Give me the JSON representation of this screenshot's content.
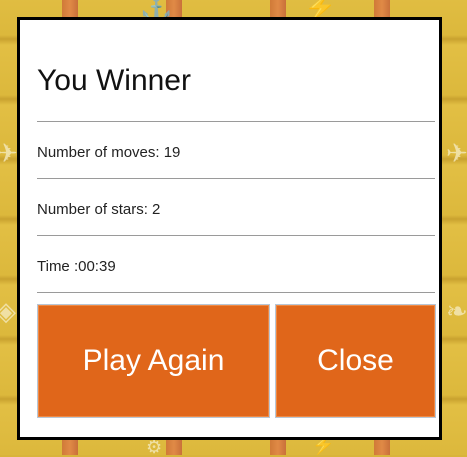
{
  "modal": {
    "title": "You Winner",
    "stats": {
      "moves_label": "Number of moves:",
      "moves_value": "19",
      "stars_label": "Number of stars:",
      "stars_value": "2",
      "time_label": "Time :",
      "time_value": "00:39"
    },
    "buttons": {
      "play_again": "Play Again",
      "close": "Close"
    }
  },
  "colors": {
    "button": "#e0661a",
    "board": "#dcb83c",
    "modal_border": "#000000"
  },
  "background_icons": [
    "anchor-icon",
    "bolt-icon",
    "paper-plane-icon",
    "cube-icon",
    "leaf-icon",
    "bicycle-icon"
  ]
}
